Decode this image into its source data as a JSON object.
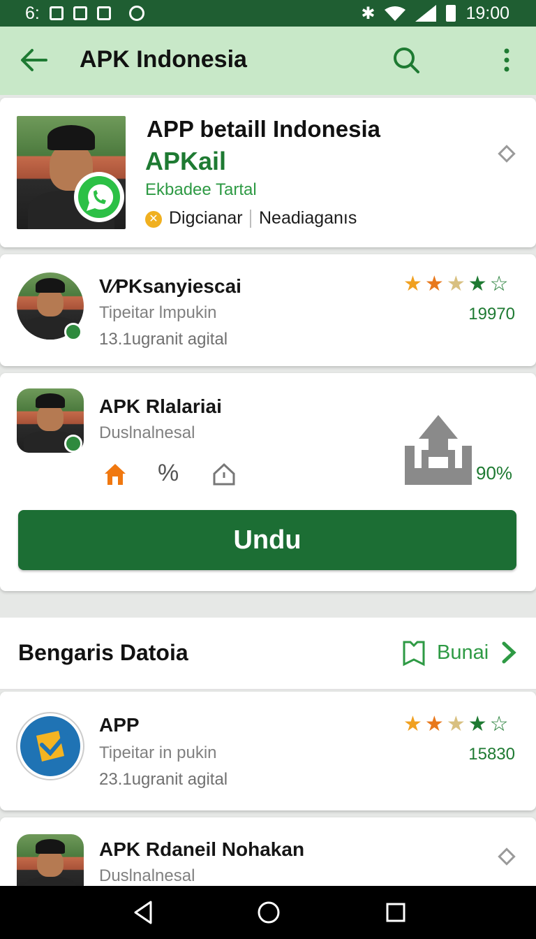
{
  "status_bar": {
    "time_left": "6:",
    "time_right": "19:00"
  },
  "app_bar": {
    "title": "APK Indonesia"
  },
  "featured": {
    "title": "APP betaill Indonesia",
    "brand": "APKail",
    "subtitle": "Ekbadee Tartal",
    "tag_1": "Digcianar",
    "tag_2": "Neadiaganıs"
  },
  "app_1": {
    "name": "V∕PKsanyiescai",
    "category": "Tipeitar lmpukin",
    "meta": "13.1ugranit agital",
    "count": "19970",
    "stars": [
      "full",
      "full",
      "half",
      "full",
      "empty"
    ]
  },
  "app_2": {
    "name": "APK Rlalariai",
    "category": "Duslnalnesal",
    "percent_symbol": "%",
    "progress": "90%",
    "button": "Undu"
  },
  "section": {
    "title": "Bengaris Datoia",
    "link": "Bunai"
  },
  "app_3": {
    "name": "APP",
    "category": "Tipeitar in pukin",
    "meta": "23.1ugranit agital",
    "count": "15830",
    "stars": [
      "full",
      "full",
      "half",
      "full",
      "empty"
    ]
  },
  "app_4": {
    "name": "APK Rdaneil Nohakan",
    "category": "Duslnalnesal"
  },
  "colors": {
    "status": "#1f5e32",
    "appbar": "#c8e8c8",
    "accent": "#1c6e34",
    "star": "#f0a020"
  }
}
